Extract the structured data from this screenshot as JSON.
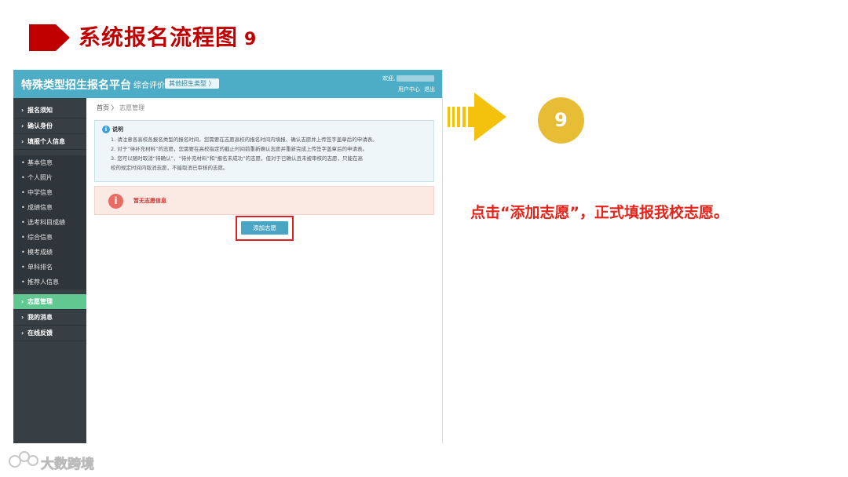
{
  "slide": {
    "title": "系统报名流程图",
    "step": "9",
    "instruction": "点击“添加志愿”，正式填报我校志愿。",
    "watermark": "大数跨境"
  },
  "header": {
    "brand": "特殊类型招生报名平台",
    "sub": "综合评价",
    "chip": "其他招生类型 〉",
    "welcome": "欢迎,",
    "links": [
      "用户中心",
      "退出"
    ]
  },
  "sidebar": {
    "top_items": [
      {
        "label": "报名须知"
      },
      {
        "label": "确认身份"
      },
      {
        "label": "填报个人信息"
      }
    ],
    "sub_items": [
      {
        "label": "基本信息"
      },
      {
        "label": "个人照片"
      },
      {
        "label": "中学信息"
      },
      {
        "label": "成绩信息"
      },
      {
        "label": "选考科目成绩"
      },
      {
        "label": "综合信息"
      },
      {
        "label": "模考成绩"
      },
      {
        "label": "单科排名"
      },
      {
        "label": "推荐人信息"
      }
    ],
    "bottom_items": [
      {
        "label": "志愿管理",
        "active": true
      },
      {
        "label": "我的消息"
      },
      {
        "label": "在线反馈"
      }
    ]
  },
  "breadcrumb": {
    "home": "首页",
    "sep": "〉",
    "current": "志愿管理"
  },
  "notice": {
    "title": "说明",
    "lines": [
      "1. 请注意各高校各报名类型的报名时间，您需要在志愿高校的报名时间内填报、确认志愿并上传签字盖章后的申请表。",
      "2. 对于“待补充材料”的志愿，您需要在高校指定的截止时间前重新确认志愿并重新完成上传签字盖章后的申请表。",
      "3. 您可以随时取消“待确认”、“待补充材料”和“报名未成功”的志愿，但对于已确认且未被审核的志愿，只能在高",
      "校的规定时间内取消志愿，不能取消已审核的志愿。"
    ]
  },
  "empty_state": {
    "icon": "i",
    "text": "暂无志愿信息"
  },
  "add_button": "添加志愿",
  "colors": {
    "title_red": "#c00000",
    "topbar": "#4dadc6",
    "sidebar": "#373f45",
    "active_green": "#62c892",
    "step_gold": "#e8bd36",
    "arrow_gold": "#f4c20d"
  }
}
